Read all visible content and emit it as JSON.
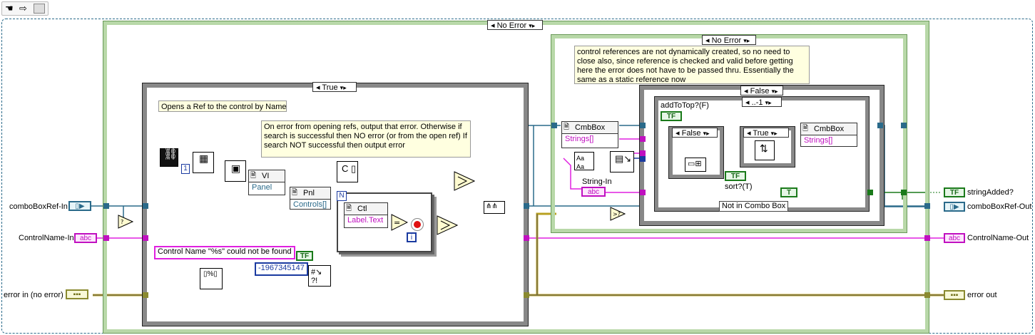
{
  "toolbar": {
    "icons": [
      "hand-tool-icon",
      "arrow-tool-icon",
      "run-arrow-icon"
    ]
  },
  "structures": {
    "outer_case_selector": "No Error",
    "true_case_selector": "True",
    "inner_right_case_selector": "No Error",
    "not_in_combo_case_selector": "False",
    "range_case_selector": "..-1",
    "add_to_top_case_selector": "False",
    "sort_case_selector": "True",
    "not_in_combo_label": "Not in Combo Box"
  },
  "comments": {
    "open_ref": "Opens a Ref to the control by Name",
    "on_error": "On error from opening refs, output that error.  Otherwise if search is successful then NO error (or from the open ref) If search NOT successful then output error",
    "static_ref": "control references are not dynamically created, so no need to close also, since reference is checked and valid before getting here the error does not have to be passed thru. Essentially the same as a static reference now"
  },
  "controls": {
    "combo_ref_in": "comboBoxRef-In",
    "control_name_in": "ControlName-In",
    "error_in": "error in (no error)"
  },
  "indicators": {
    "string_added": "stringAdded?",
    "combo_ref_out": "comboBoxRef-Out",
    "control_name_out": "ControlName-Out",
    "error_out": "error out"
  },
  "nodes": {
    "vi_prop": "VI",
    "vi_prop_row": "Panel",
    "pnl_prop": "Pnl",
    "pnl_prop_row": "Controls[]",
    "ctl_prop": "Ctl",
    "ctl_prop_row": "Label.Text",
    "cmbbox_left": "CmbBox",
    "cmbbox_left_row": "Strings[]",
    "cmbbox_right": "CmbBox",
    "cmbbox_right_row": "Strings[]",
    "format_string": "Control Name \"%s\" could not be found",
    "error_code": "-1967345147",
    "string_in_label": "String-In",
    "add_to_top_label": "addToTop?(F)",
    "sort_label": "sort?(T)"
  },
  "terminal_text": {
    "ref": "",
    "abc": "abc",
    "err": "",
    "tf": "TF",
    "t": "T"
  },
  "colors": {
    "ref_wire": "#2a6a8a",
    "string_wire": "#e020e0",
    "error_wire": "#b8a020",
    "bool_wire": "#1a7a1a",
    "int_wire": "#1a3aa0",
    "case_border": "#6a9a5a"
  }
}
